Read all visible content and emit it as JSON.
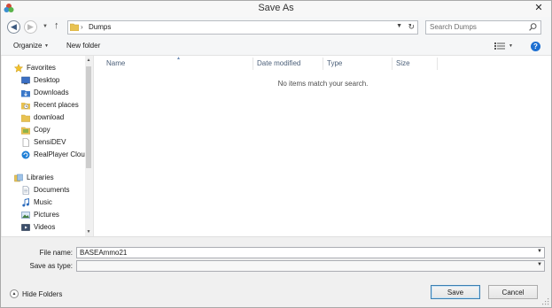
{
  "window": {
    "title": "Save As",
    "close_glyph": "✕"
  },
  "nav": {
    "back_glyph": "◀",
    "forward_glyph": "▶",
    "up_glyph": "↑",
    "address": {
      "separator": "›",
      "current_folder": "Dumps"
    },
    "search": {
      "placeholder": "Search Dumps"
    }
  },
  "toolbar": {
    "organize_label": "Organize",
    "new_folder_label": "New folder",
    "help_glyph": "?"
  },
  "navpane": {
    "favorites": {
      "label": "Favorites",
      "items": [
        {
          "label": "Desktop",
          "icon": "desktop-icon"
        },
        {
          "label": "Downloads",
          "icon": "downloads-icon"
        },
        {
          "label": "Recent places",
          "icon": "recent-places-icon"
        },
        {
          "label": "download",
          "icon": "folder-icon"
        },
        {
          "label": "Copy",
          "icon": "folder-icon"
        },
        {
          "label": "SensiDEV",
          "icon": "file-icon"
        },
        {
          "label": "RealPlayer Cloud",
          "icon": "realplayer-icon"
        }
      ]
    },
    "libraries": {
      "label": "Libraries",
      "items": [
        {
          "label": "Documents",
          "icon": "documents-icon"
        },
        {
          "label": "Music",
          "icon": "music-icon"
        },
        {
          "label": "Pictures",
          "icon": "pictures-icon"
        },
        {
          "label": "Videos",
          "icon": "videos-icon"
        }
      ]
    }
  },
  "filelist": {
    "columns": [
      "Name",
      "Date modified",
      "Type",
      "Size"
    ],
    "empty_message": "No items match your search."
  },
  "form": {
    "filename_label": "File name:",
    "filename_value": "BASEAmmo21",
    "savetype_label": "Save as type:",
    "savetype_value": ""
  },
  "footer": {
    "hide_folders_label": "Hide Folders",
    "save_label": "Save",
    "cancel_label": "Cancel"
  },
  "colors": {
    "help_button": "#1d6fd1",
    "folder": "#e8c252",
    "column_header_text": "#4c607a"
  }
}
